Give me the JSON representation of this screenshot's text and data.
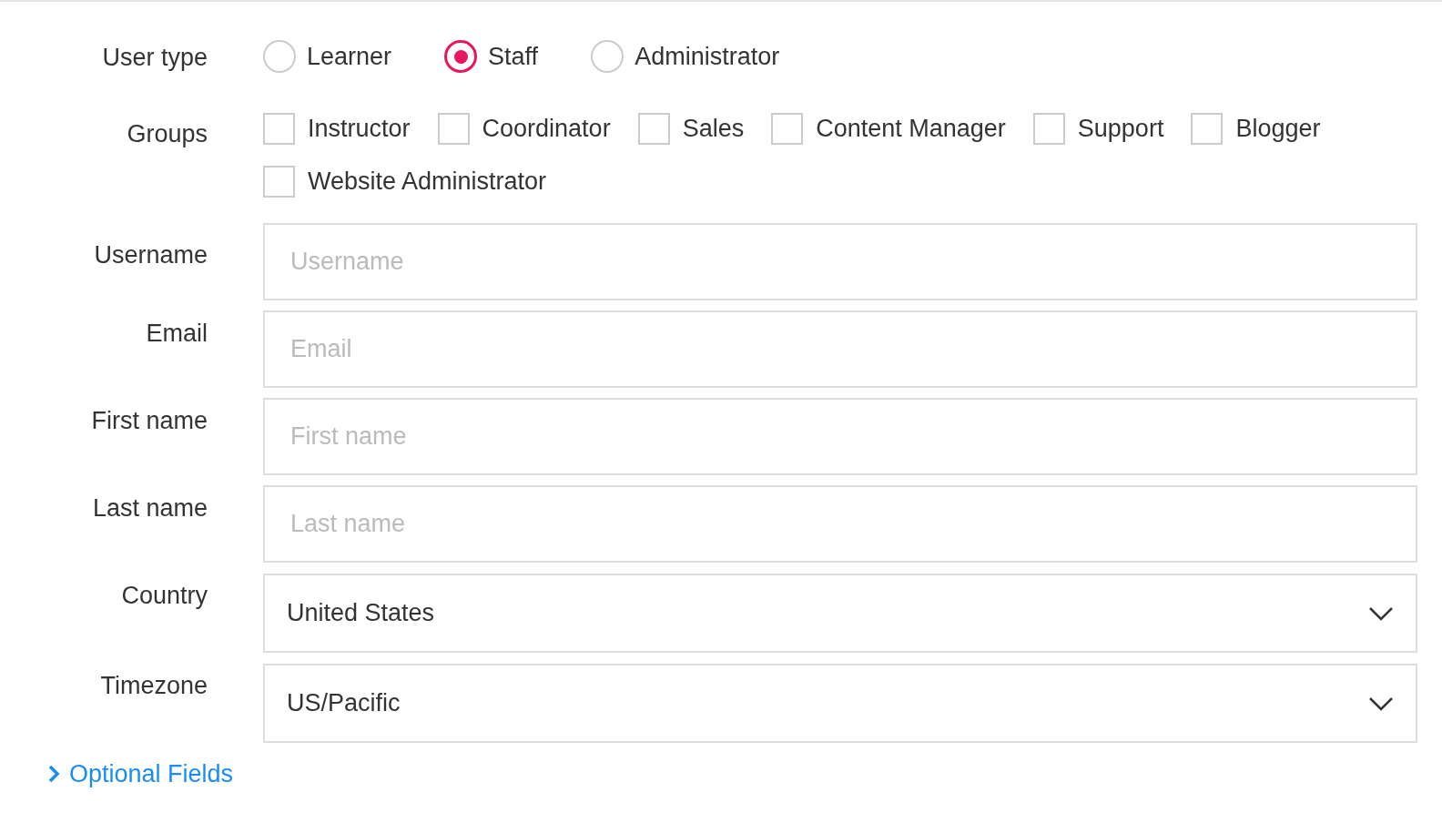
{
  "user_type": {
    "label": "User type",
    "options": [
      {
        "label": "Learner",
        "selected": false
      },
      {
        "label": "Staff",
        "selected": true
      },
      {
        "label": "Administrator",
        "selected": false
      }
    ]
  },
  "groups": {
    "label": "Groups",
    "options": [
      {
        "label": "Instructor",
        "checked": false
      },
      {
        "label": "Coordinator",
        "checked": false
      },
      {
        "label": "Sales",
        "checked": false
      },
      {
        "label": "Content Manager",
        "checked": false
      },
      {
        "label": "Support",
        "checked": false
      },
      {
        "label": "Blogger",
        "checked": false
      },
      {
        "label": "Website Administrator",
        "checked": false
      }
    ]
  },
  "fields": [
    {
      "kind": "text",
      "label": "Username",
      "placeholder": "Username"
    },
    {
      "kind": "text",
      "label": "Email",
      "placeholder": "Email"
    },
    {
      "kind": "text",
      "label": "First name",
      "placeholder": "First name"
    },
    {
      "kind": "text",
      "label": "Last name",
      "placeholder": "Last name"
    },
    {
      "kind": "select",
      "label": "Country",
      "value": "United States"
    },
    {
      "kind": "select",
      "label": "Timezone",
      "value": "US/Pacific"
    }
  ],
  "optional_fields": {
    "label": "Optional Fields",
    "expanded": false
  }
}
